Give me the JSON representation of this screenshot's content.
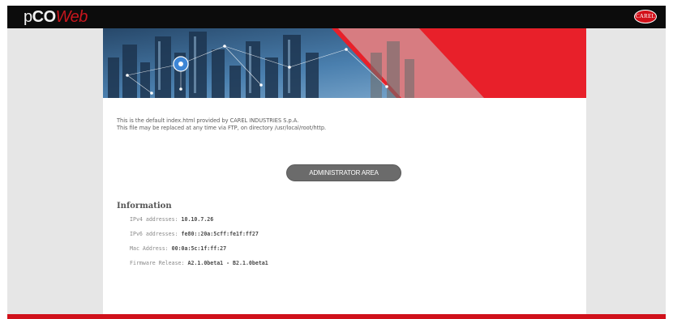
{
  "header": {
    "logo_part1": "p",
    "logo_part2": "CO",
    "logo_part3": "Web",
    "brand_badge": "CAREL"
  },
  "intro": {
    "line1": "This is the default index.html provided by CAREL INDUSTRIES S.p.A.",
    "line2": "This file may be replaced at any time via FTP, on directory /usr/local/root/http."
  },
  "admin_button_label": "ADMINISTRATOR AREA",
  "information": {
    "title": "Information",
    "rows": [
      {
        "label": "IPv4 addresses:",
        "value": "10.10.7.26"
      },
      {
        "label": "IPv6 addresses:",
        "value": "fe80::20a:5cff:fe1f:ff27"
      },
      {
        "label": "Mac Address:",
        "value": "00:0a:5c:1f:ff:27"
      },
      {
        "label": "Firmware Release:",
        "value": "A2.1.0beta1 - B2.1.0beta1"
      }
    ]
  },
  "colors": {
    "accent_red": "#d0111b",
    "topbar": "#0c0c0c",
    "side_gray": "#e6e6e6",
    "button_gray": "#6b6b6b"
  },
  "icons": [
    "city-network-banner",
    "carel-logo-icon"
  ]
}
